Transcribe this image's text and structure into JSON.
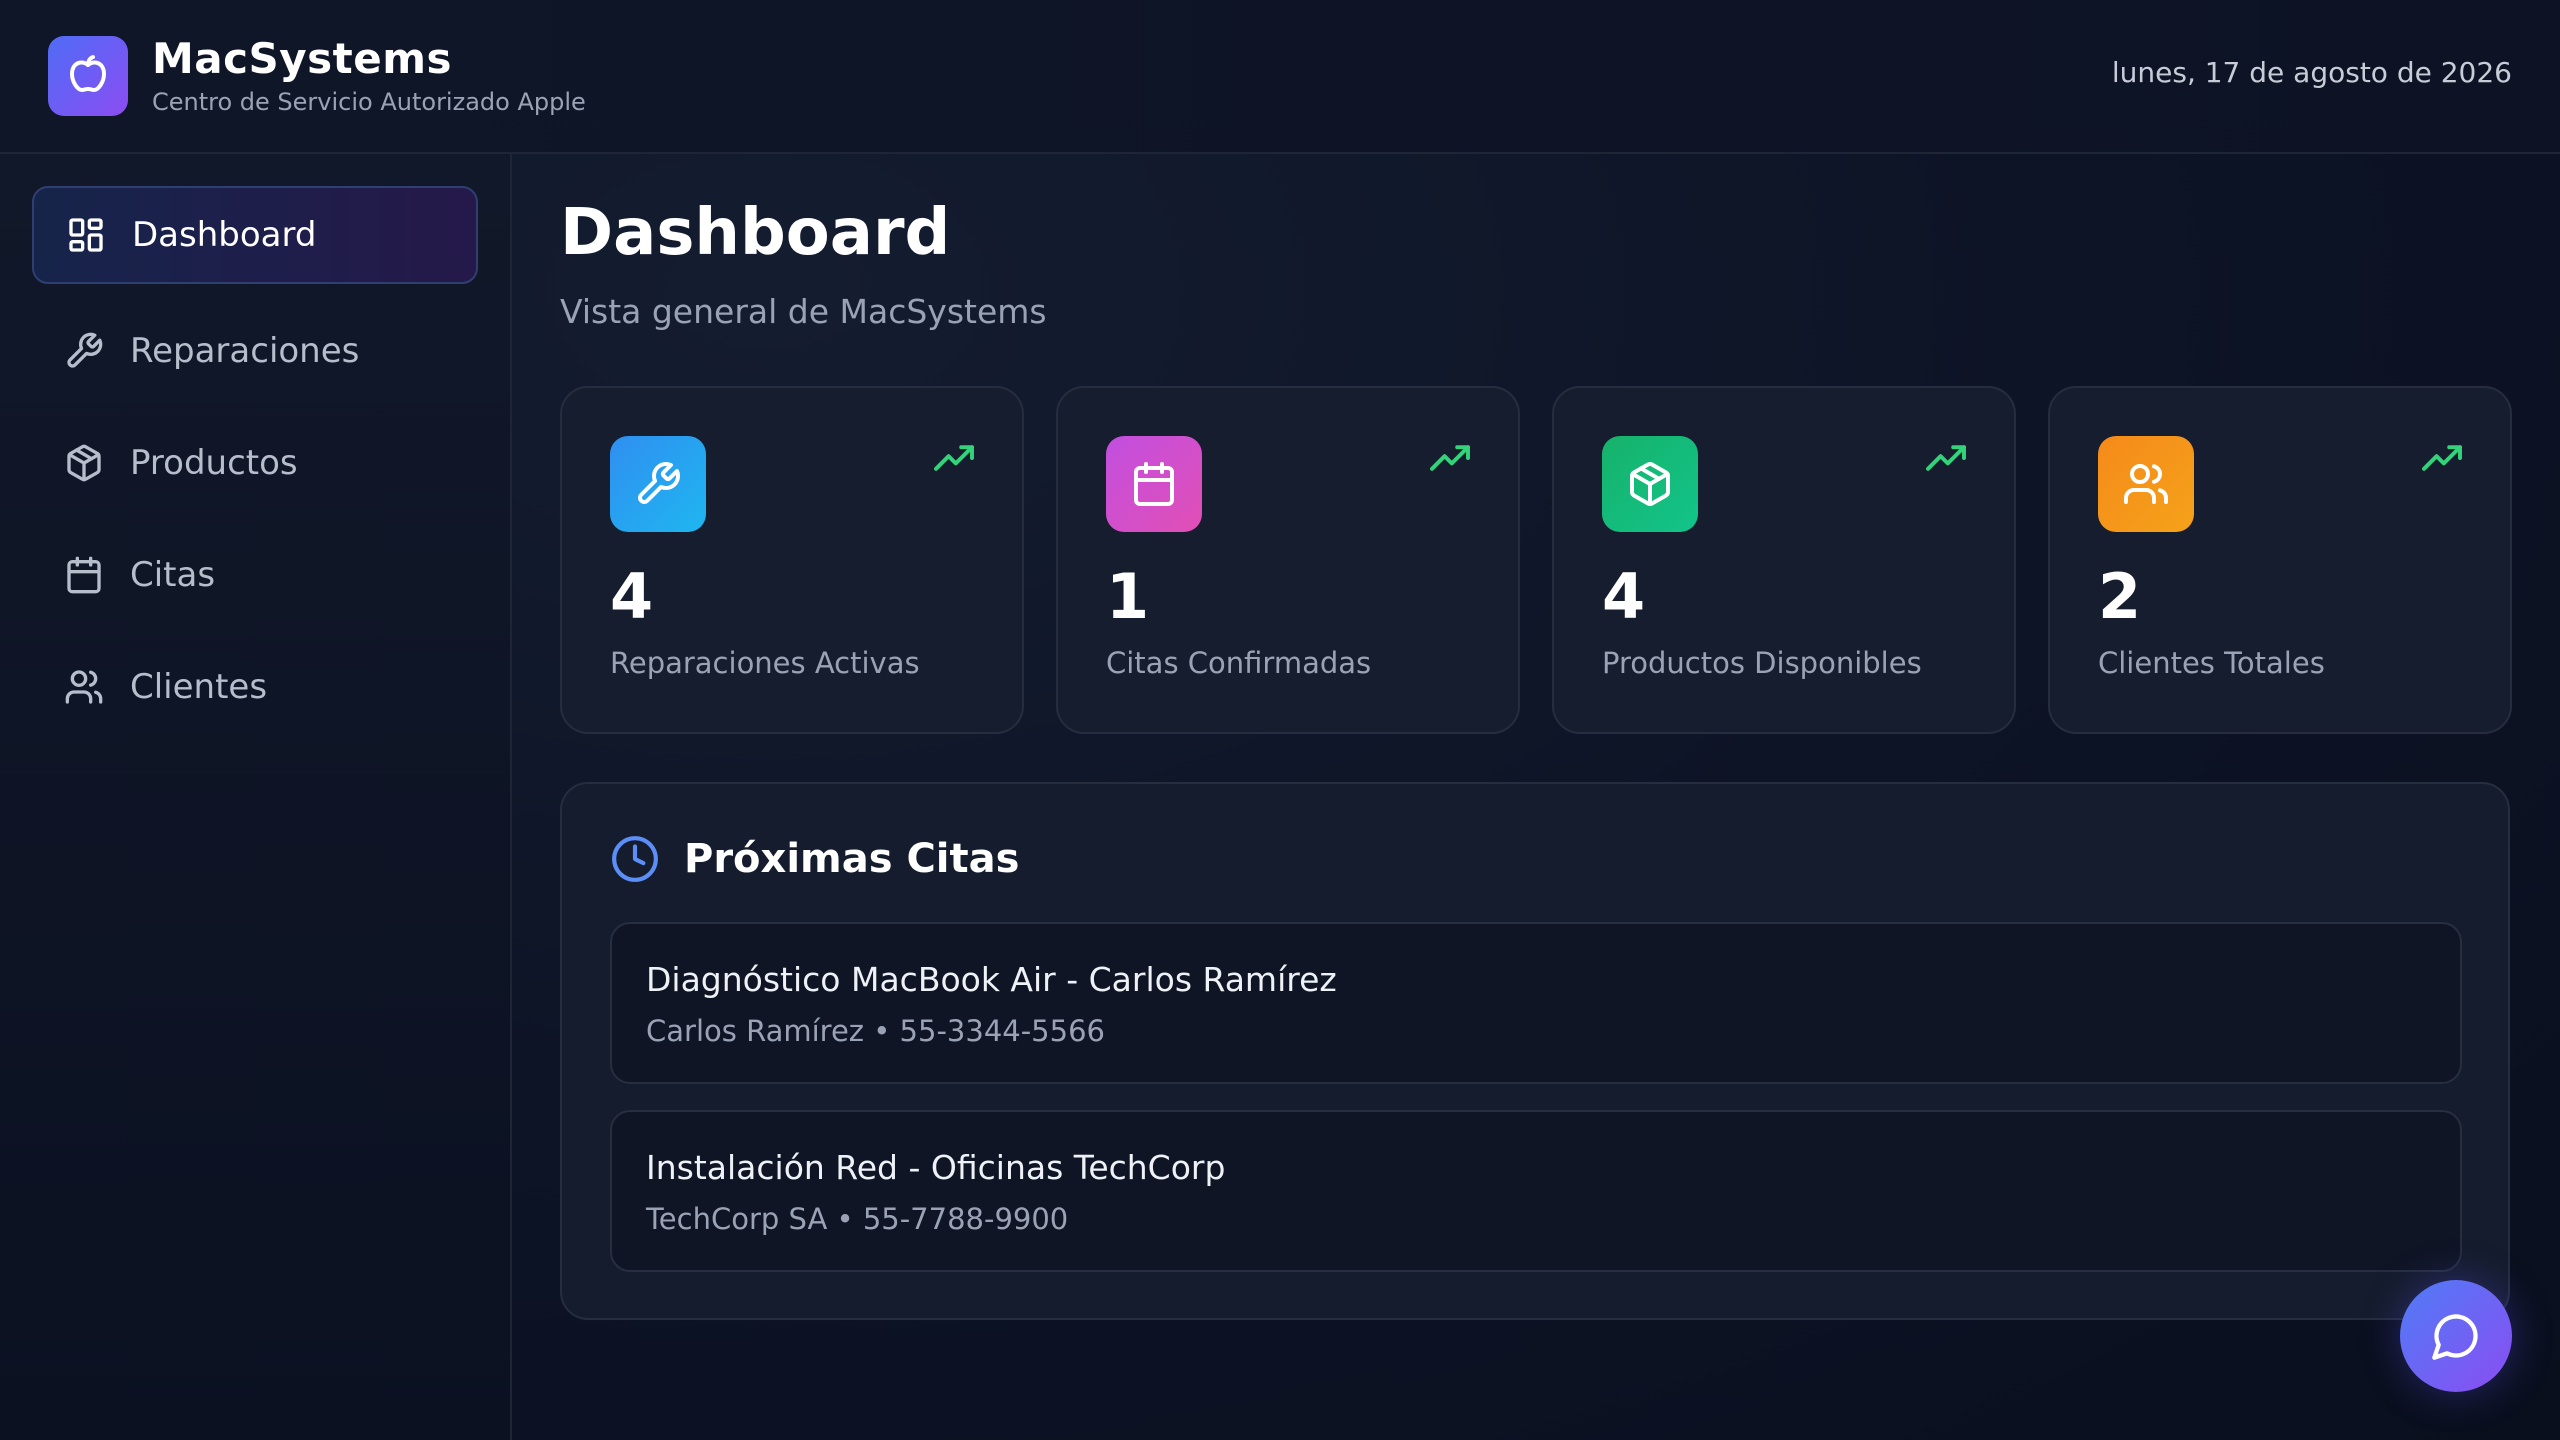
{
  "header": {
    "brand_name": "MacSystems",
    "brand_subtitle": "Centro de Servicio Autorizado Apple",
    "date": "lunes, 17 de agosto de 2026"
  },
  "sidebar": {
    "items": [
      {
        "label": "Dashboard",
        "icon": "dashboard-grid-icon",
        "active": true
      },
      {
        "label": "Reparaciones",
        "icon": "wrench-icon",
        "active": false
      },
      {
        "label": "Productos",
        "icon": "package-icon",
        "active": false
      },
      {
        "label": "Citas",
        "icon": "calendar-icon",
        "active": false
      },
      {
        "label": "Clientes",
        "icon": "users-icon",
        "active": false
      }
    ]
  },
  "main": {
    "title": "Dashboard",
    "subtitle": "Vista general de MacSystems",
    "stats": [
      {
        "value": "4",
        "label": "Reparaciones Activas",
        "icon": "wrench-icon",
        "color": "#2f8ff0"
      },
      {
        "value": "1",
        "label": "Citas Confirmadas",
        "icon": "calendar-icon",
        "color": "#c24fe0"
      },
      {
        "value": "4",
        "label": "Productos Disponibles",
        "icon": "package-icon",
        "color": "#16b26a"
      },
      {
        "value": "2",
        "label": "Clientes Totales",
        "icon": "users-icon",
        "color": "#f58a1a"
      }
    ],
    "appointments": {
      "title": "Próximas Citas",
      "items": [
        {
          "title": "Diagnóstico MacBook Air - Carlos Ramírez",
          "meta": "Carlos Ramírez • 55-3344-5566"
        },
        {
          "title": "Instalación Red - Oficinas TechCorp",
          "meta": "TechCorp SA • 55-7788-9900"
        }
      ]
    }
  },
  "colors": {
    "accent_trend": "#34d27a",
    "accent_clock": "#5b8ef7",
    "brand_gradient_start": "#4f6cf5",
    "brand_gradient_end": "#8b4df2"
  }
}
